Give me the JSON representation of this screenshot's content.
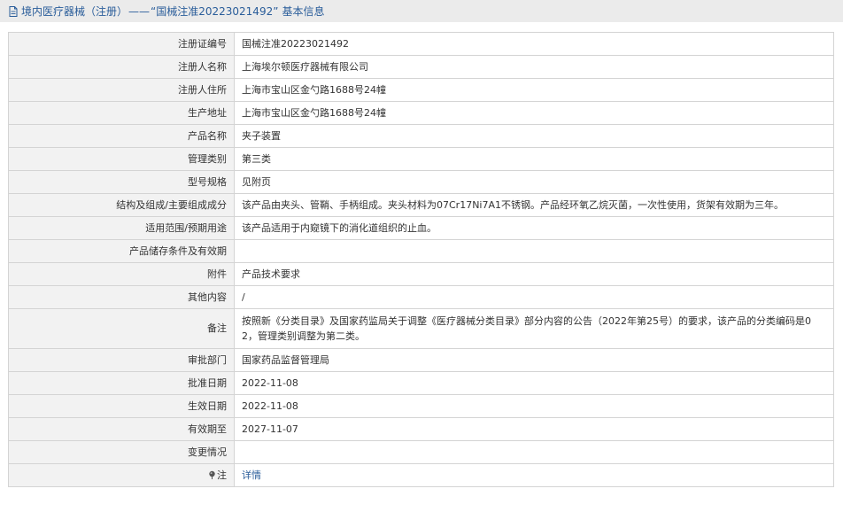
{
  "header": {
    "category": "境内医疗器械（注册）",
    "dash": "——",
    "reg_no_quoted": "“国械注准20223021492”",
    "suffix": "基本信息"
  },
  "rows": [
    {
      "label": "注册证编号",
      "value": "国械注准20223021492"
    },
    {
      "label": "注册人名称",
      "value": "上海埃尔顿医疗器械有限公司"
    },
    {
      "label": "注册人住所",
      "value": "上海市宝山区金勺路1688号24幢"
    },
    {
      "label": "生产地址",
      "value": "上海市宝山区金勺路1688号24幢"
    },
    {
      "label": "产品名称",
      "value": "夹子装置"
    },
    {
      "label": "管理类别",
      "value": "第三类"
    },
    {
      "label": "型号规格",
      "value": "见附页"
    },
    {
      "label": "结构及组成/主要组成成分",
      "value": "该产品由夹头、管鞘、手柄组成。夹头材料为07Cr17Ni7A1不锈钢。产品经环氧乙烷灭菌，一次性使用，货架有效期为三年。"
    },
    {
      "label": "适用范围/预期用途",
      "value": "该产品适用于内窥镜下的消化道组织的止血。"
    },
    {
      "label": "产品储存条件及有效期",
      "value": ""
    },
    {
      "label": "附件",
      "value": "产品技术要求"
    },
    {
      "label": "其他内容",
      "value": "/"
    },
    {
      "label": "备注",
      "value": "按照新《分类目录》及国家药监局关于调整《医疗器械分类目录》部分内容的公告（2022年第25号）的要求，该产品的分类编码是02，管理类别调整为第二类。"
    },
    {
      "label": "审批部门",
      "value": "国家药品监督管理局"
    },
    {
      "label": "批准日期",
      "value": "2022-11-08"
    },
    {
      "label": "生效日期",
      "value": "2022-11-08"
    },
    {
      "label": "有效期至",
      "value": "2027-11-07"
    },
    {
      "label": "变更情况",
      "value": ""
    }
  ],
  "note_row": {
    "label": "注",
    "link": "详情"
  }
}
